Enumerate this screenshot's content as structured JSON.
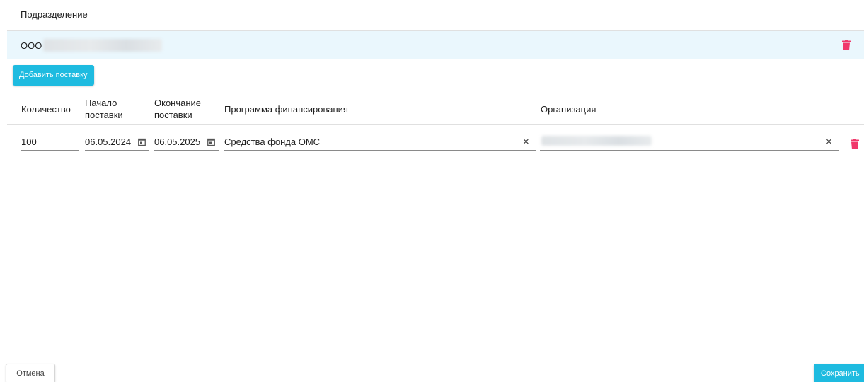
{
  "section": {
    "title": "Подразделение"
  },
  "division": {
    "name_prefix": "ООО"
  },
  "actions": {
    "add_supply_label": "Добавить поставку"
  },
  "table": {
    "headers": {
      "quantity": "Количество",
      "start_line1": "Начало",
      "start_line2": "поставки",
      "end_line1": "Окончание",
      "end_line2": "поставки",
      "program": "Программа финансирования",
      "organization": "Организация"
    },
    "rows": [
      {
        "quantity": "100",
        "start_date": "06.05.2024",
        "end_date": "06.05.2025",
        "program": "Средства фонда ОМС"
      }
    ]
  },
  "footer": {
    "cancel_label": "Отмена",
    "save_label": "Сохранить"
  },
  "icons": {
    "delete": "trash-icon",
    "calendar": "calendar-icon",
    "clear": "close-icon"
  },
  "colors": {
    "accent": "#1ebbe0",
    "delete": "#f0386b",
    "selected_row": "#eaf7fd"
  }
}
